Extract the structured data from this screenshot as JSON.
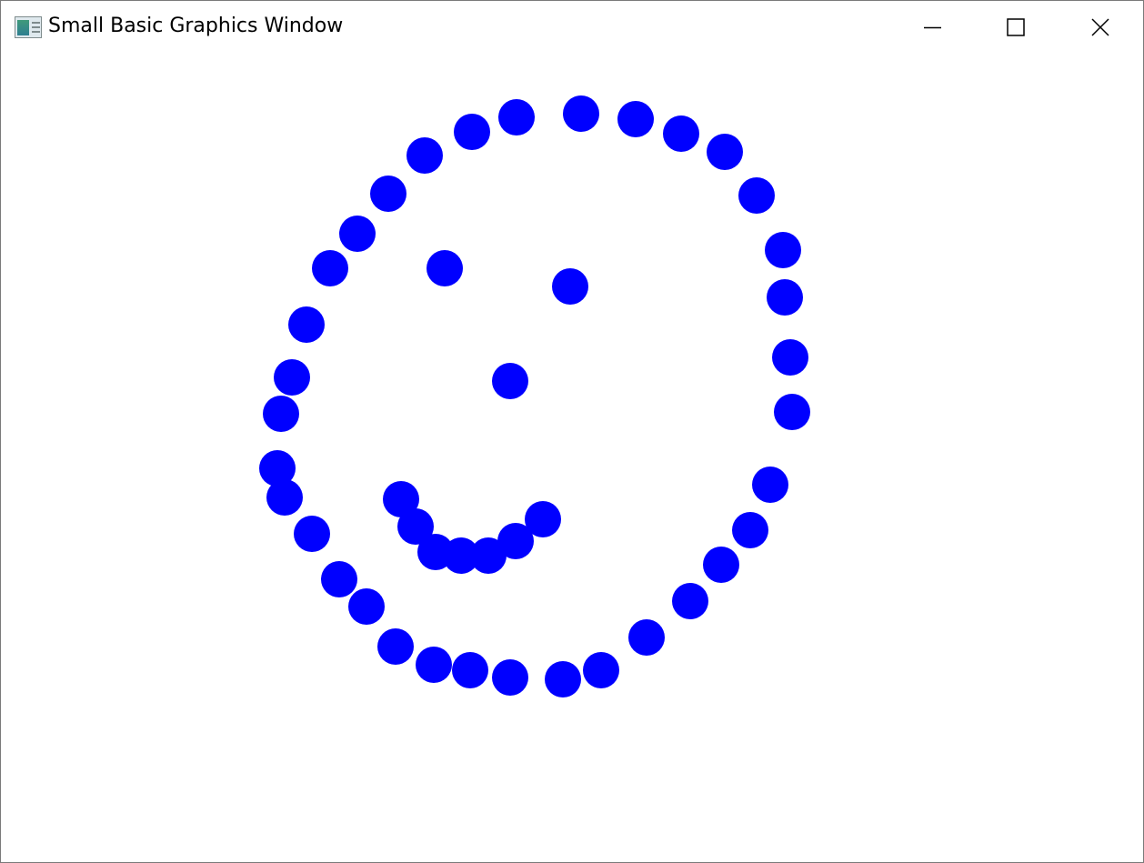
{
  "window": {
    "title": "Small Basic Graphics Window",
    "icon": "small-basic-app-icon",
    "controls": {
      "minimize": "minimize-icon",
      "maximize": "maximize-icon",
      "close": "close-icon"
    }
  },
  "drawing": {
    "shape": "ellipse",
    "fill": "#0000ff",
    "background": "#ffffff"
  }
}
